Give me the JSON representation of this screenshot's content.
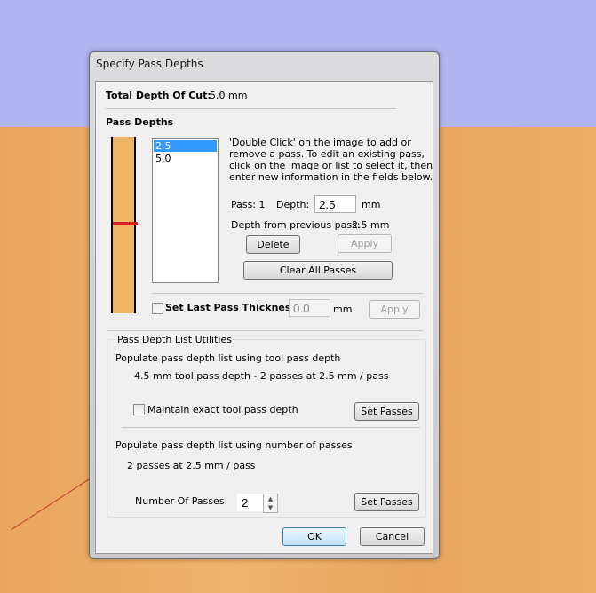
{
  "dialog": {
    "title": "Specify Pass Depths"
  },
  "total": {
    "label": "Total Depth Of Cut:",
    "value": "5.0 mm"
  },
  "pass_depths": {
    "heading": "Pass Depths",
    "list": [
      "2.5",
      "5.0"
    ],
    "selected_index": 0,
    "instructions": [
      "'Double Click' on the image to add or",
      "remove a pass. To edit an existing pass,",
      "click on the image or list to select it, then",
      "enter new information in the fields below."
    ],
    "pass_label": "Pass: 1",
    "depth_label": "Depth:",
    "depth_value": "2.5",
    "depth_unit": "mm",
    "prev_label": "Depth from previous pass:",
    "prev_value": "2.5 mm",
    "delete": "Delete",
    "apply": "Apply",
    "clear_all": "Clear All Passes"
  },
  "last_pass": {
    "label": "Set Last Pass Thickness",
    "checked": false,
    "value": "0.0",
    "unit": "mm",
    "apply": "Apply"
  },
  "utilities": {
    "legend": "Pass Depth List Utilities",
    "tool_heading": "Populate pass depth list using tool pass depth",
    "tool_summary": "4.5 mm tool pass depth - 2 passes at 2.5 mm / pass",
    "maintain_label": "Maintain exact tool pass depth",
    "maintain_checked": false,
    "set_passes": "Set Passes",
    "num_heading": "Populate pass depth list using number of passes",
    "num_summary": "2 passes at 2.5 mm / pass",
    "num_label": "Number Of Passes:",
    "num_value": "2"
  },
  "footer": {
    "ok": "OK",
    "cancel": "Cancel"
  }
}
